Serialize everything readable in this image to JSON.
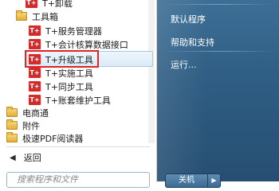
{
  "programs": [
    {
      "label": "T+卸载",
      "icon": "tplus-icon",
      "indent": 1
    },
    {
      "label": "工具箱",
      "icon": "folder-icon",
      "indent": 1
    },
    {
      "label": "T+服务管理器",
      "icon": "tplus-icon",
      "indent": 2
    },
    {
      "label": "T+会计核算数据接口",
      "icon": "tplus-icon",
      "indent": 2
    },
    {
      "label": "T+升级工具",
      "icon": "tplus-icon",
      "indent": 2,
      "highlighted": true
    },
    {
      "label": "T+实施工具",
      "icon": "tplus-icon",
      "indent": 2
    },
    {
      "label": "T+同步工具",
      "icon": "tplus-icon",
      "indent": 2
    },
    {
      "label": "T+账套维护工具",
      "icon": "tplus-icon",
      "indent": 2
    },
    {
      "label": "电商通",
      "icon": "folder-icon",
      "indent": 0
    },
    {
      "label": "附件",
      "icon": "folder-icon",
      "indent": 0
    },
    {
      "label": "极速PDF阅读器",
      "icon": "folder-icon",
      "indent": 0
    }
  ],
  "back_label": "返回",
  "search_placeholder": "搜索程序和文件",
  "right_pane": {
    "items": [
      "默认程序",
      "帮助和支持",
      "运行..."
    ]
  },
  "shutdown_label": "关机",
  "tplus_badge": "T+",
  "colors": {
    "accent_red": "#e02424",
    "right_pane": "#2f5d83"
  }
}
